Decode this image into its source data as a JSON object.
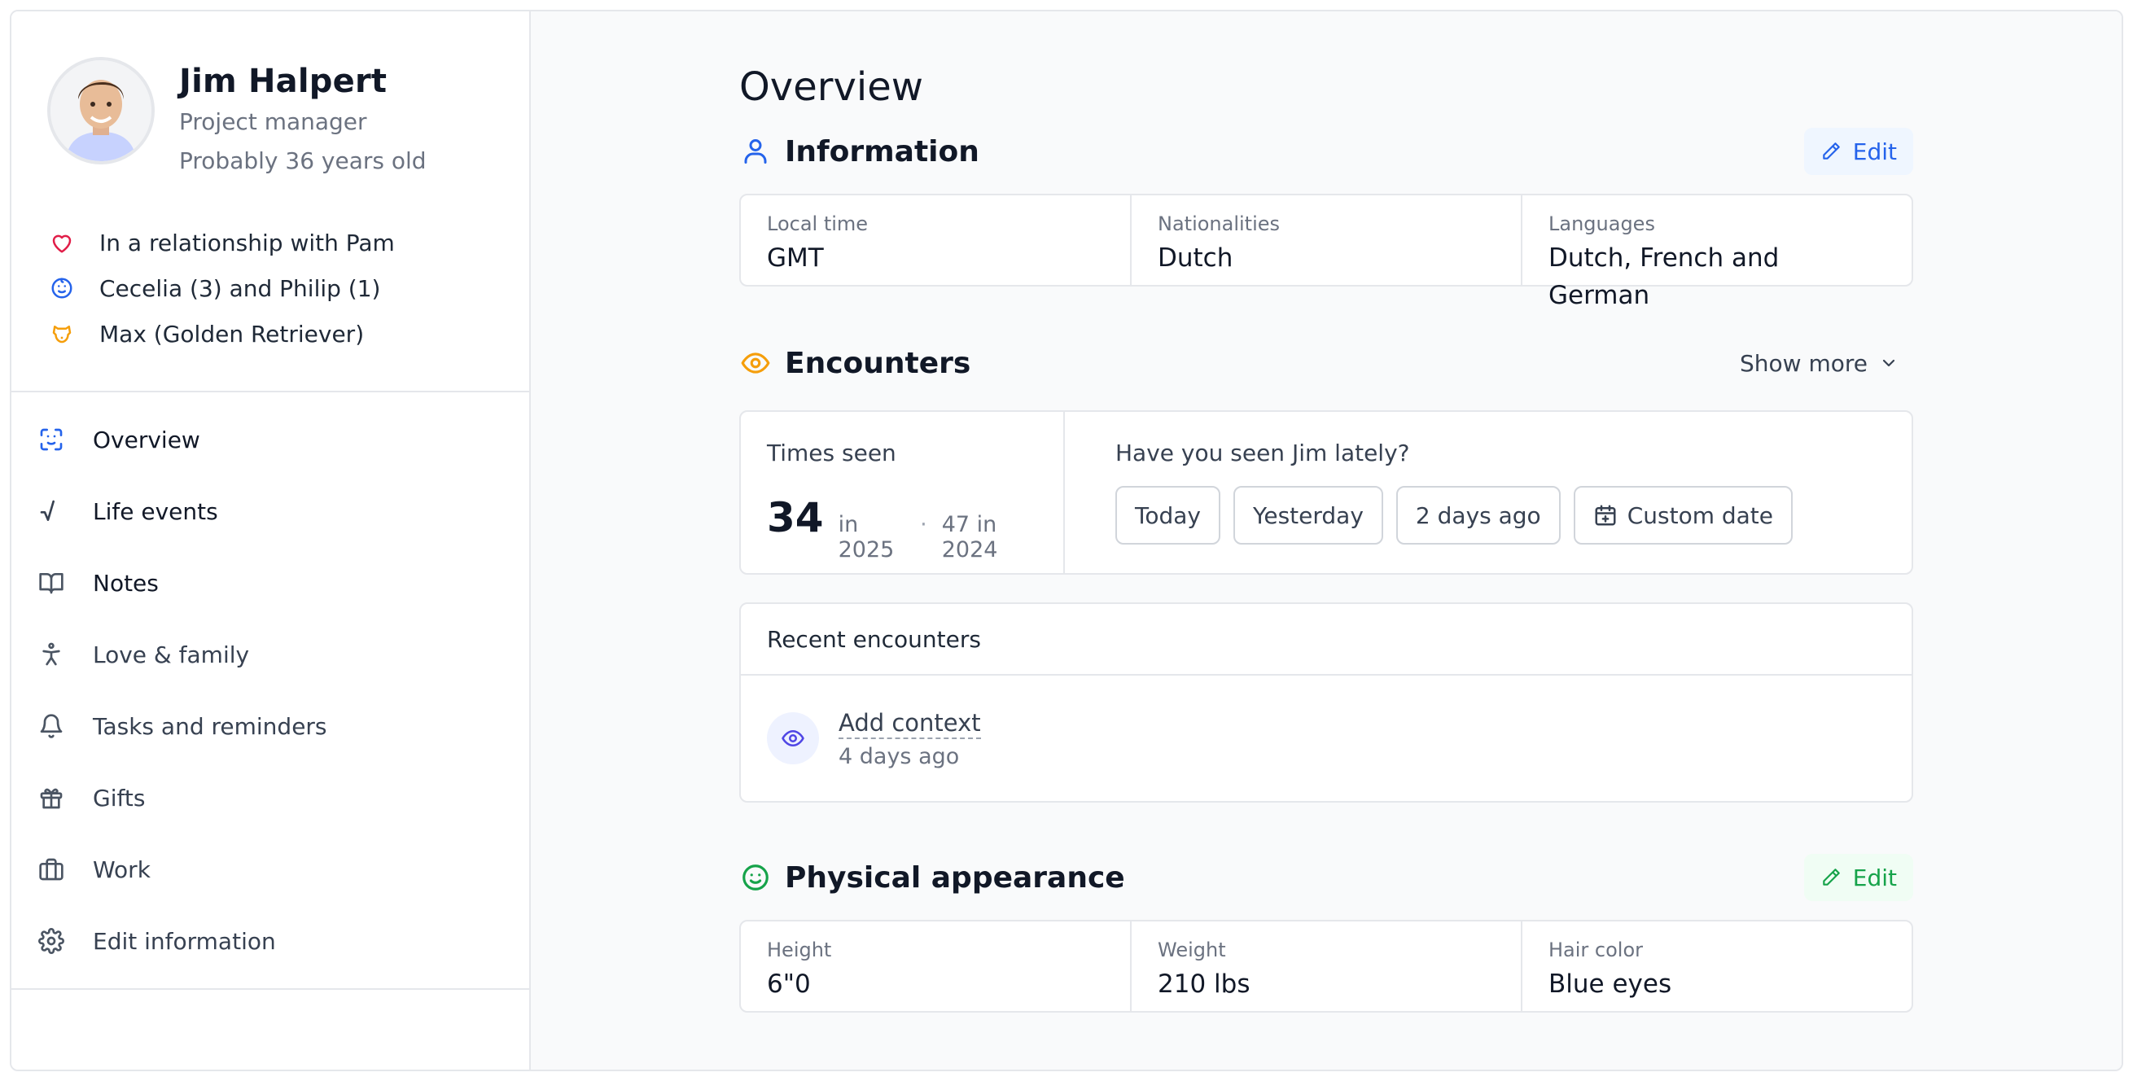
{
  "profile": {
    "name": "Jim Halpert",
    "role": "Project manager",
    "age": "Probably 36 years old"
  },
  "facts": [
    {
      "icon": "heart-icon",
      "text": "In a relationship with Pam",
      "color": "#e11d48"
    },
    {
      "icon": "baby-icon",
      "text": "Cecelia (3) and Philip (1)",
      "color": "#2563eb"
    },
    {
      "icon": "dog-icon",
      "text": "Max (Golden Retriever)",
      "color": "#f59e0b"
    }
  ],
  "nav": [
    {
      "icon": "face-scan-icon",
      "label": "Overview",
      "active": true
    },
    {
      "icon": "square-root-icon",
      "label": "Life events"
    },
    {
      "icon": "book-icon",
      "label": "Notes"
    },
    {
      "icon": "person-icon",
      "label": "Love & family"
    },
    {
      "icon": "bell-icon",
      "label": "Tasks and reminders"
    },
    {
      "icon": "gift-icon",
      "label": "Gifts"
    },
    {
      "icon": "briefcase-icon",
      "label": "Work"
    },
    {
      "icon": "gear-icon",
      "label": "Edit information"
    }
  ],
  "main": {
    "title": "Overview",
    "information": {
      "title": "Information",
      "edit_label": "Edit",
      "fields": [
        {
          "label": "Local time",
          "value": "GMT"
        },
        {
          "label": "Nationalities",
          "value": "Dutch"
        },
        {
          "label": "Languages",
          "value": "Dutch, French and German"
        }
      ]
    },
    "encounters": {
      "title": "Encounters",
      "show_more": "Show more",
      "times_seen_label": "Times seen",
      "count": "34",
      "this_year": "in 2025",
      "last_year": "47 in 2024",
      "question": "Have you seen Jim lately?",
      "buttons": [
        "Today",
        "Yesterday",
        "2 days ago",
        "Custom date"
      ],
      "recent_title": "Recent encounters",
      "recent": [
        {
          "title": "Add context",
          "time": "4 days ago"
        }
      ]
    },
    "physical": {
      "title": "Physical appearance",
      "edit_label": "Edit",
      "fields": [
        {
          "label": "Height",
          "value": "6\"0"
        },
        {
          "label": "Weight",
          "value": "210 lbs"
        },
        {
          "label": "Hair color",
          "value": "Blue eyes"
        }
      ]
    }
  },
  "colors": {
    "accent_blue": "#2563eb",
    "accent_green": "#16a34a",
    "accent_orange": "#f59e0b",
    "accent_indigo": "#4f46e5"
  }
}
